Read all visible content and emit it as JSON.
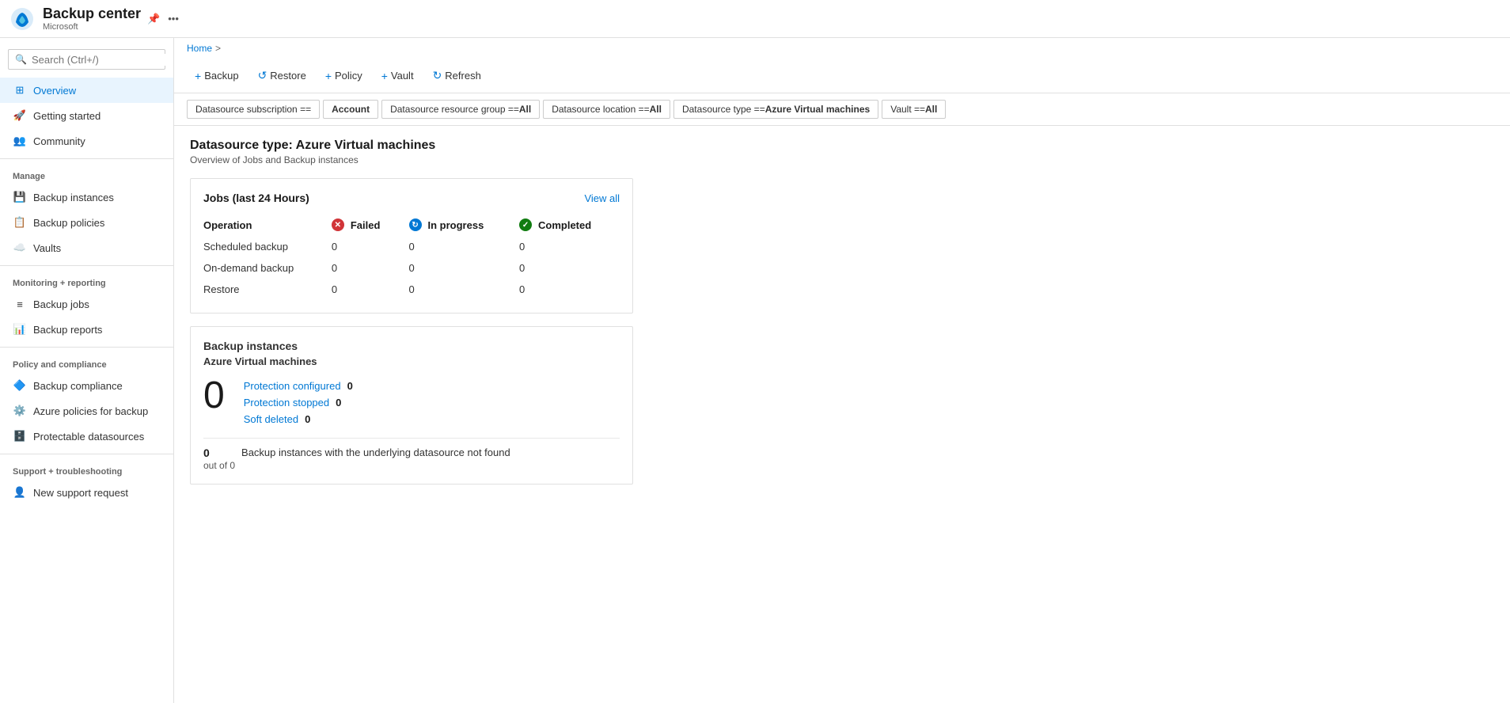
{
  "header": {
    "title": "Backup center",
    "subtitle": "Microsoft"
  },
  "breadcrumb": {
    "home": "Home",
    "separator": ">"
  },
  "search": {
    "placeholder": "Search (Ctrl+/)"
  },
  "toolbar": {
    "buttons": [
      {
        "id": "backup",
        "label": "Backup",
        "icon": "+"
      },
      {
        "id": "restore",
        "label": "Restore",
        "icon": "↺"
      },
      {
        "id": "policy",
        "label": "Policy",
        "icon": "+"
      },
      {
        "id": "vault",
        "label": "Vault",
        "icon": "+"
      },
      {
        "id": "refresh",
        "label": "Refresh",
        "icon": "↻"
      }
    ]
  },
  "filters": [
    {
      "id": "subscription",
      "text": "Datasource subscription == ",
      "bold": ""
    },
    {
      "id": "account",
      "text": "",
      "bold": "Account"
    },
    {
      "id": "resourcegroup",
      "text": "Datasource resource group == ",
      "bold": "All"
    },
    {
      "id": "location",
      "text": "Datasource location == ",
      "bold": "All"
    },
    {
      "id": "datasourcetype",
      "text": "Datasource type == ",
      "bold": "Azure Virtual machines"
    },
    {
      "id": "vault",
      "text": "Vault == ",
      "bold": "All"
    }
  ],
  "page": {
    "title": "Datasource type: Azure Virtual machines",
    "subtitle": "Overview of Jobs and Backup instances"
  },
  "sidebar": {
    "items": [
      {
        "id": "overview",
        "label": "Overview",
        "icon": "grid",
        "active": true,
        "section": ""
      },
      {
        "id": "getting-started",
        "label": "Getting started",
        "icon": "rocket",
        "active": false,
        "section": ""
      },
      {
        "id": "community",
        "label": "Community",
        "icon": "people",
        "active": false,
        "section": ""
      },
      {
        "id": "backup-instances",
        "label": "Backup instances",
        "icon": "instance",
        "active": false,
        "section": "Manage"
      },
      {
        "id": "backup-policies",
        "label": "Backup policies",
        "icon": "policy",
        "active": false,
        "section": ""
      },
      {
        "id": "vaults",
        "label": "Vaults",
        "icon": "vault",
        "active": false,
        "section": ""
      },
      {
        "id": "backup-jobs",
        "label": "Backup jobs",
        "icon": "jobs",
        "active": false,
        "section": "Monitoring + reporting"
      },
      {
        "id": "backup-reports",
        "label": "Backup reports",
        "icon": "reports",
        "active": false,
        "section": ""
      },
      {
        "id": "backup-compliance",
        "label": "Backup compliance",
        "icon": "compliance",
        "active": false,
        "section": "Policy and compliance"
      },
      {
        "id": "azure-policies",
        "label": "Azure policies for backup",
        "icon": "azpolicy",
        "active": false,
        "section": ""
      },
      {
        "id": "protectable-datasources",
        "label": "Protectable datasources",
        "icon": "protectable",
        "active": false,
        "section": ""
      },
      {
        "id": "new-support",
        "label": "New support request",
        "icon": "support",
        "active": false,
        "section": "Support + troubleshooting"
      }
    ]
  },
  "jobs_card": {
    "title": "Jobs (last 24 Hours)",
    "view_all": "View all",
    "columns": {
      "operation": "Operation",
      "failed": "Failed",
      "in_progress": "In progress",
      "completed": "Completed"
    },
    "rows": [
      {
        "operation": "Scheduled backup",
        "failed": "0",
        "in_progress": "0",
        "completed": "0"
      },
      {
        "operation": "On-demand backup",
        "failed": "0",
        "in_progress": "0",
        "completed": "0"
      },
      {
        "operation": "Restore",
        "failed": "0",
        "in_progress": "0",
        "completed": "0"
      }
    ]
  },
  "backup_instances_card": {
    "title": "Backup instances",
    "subtitle": "Azure Virtual machines",
    "big_number": "0",
    "stats": [
      {
        "label": "Protection configured",
        "value": "0"
      },
      {
        "label": "Protection stopped",
        "value": "0"
      },
      {
        "label": "Soft deleted",
        "value": "0"
      }
    ],
    "footer": {
      "count": "0",
      "out_of": "out of 0",
      "description": "Backup instances with the underlying datasource not found"
    }
  }
}
